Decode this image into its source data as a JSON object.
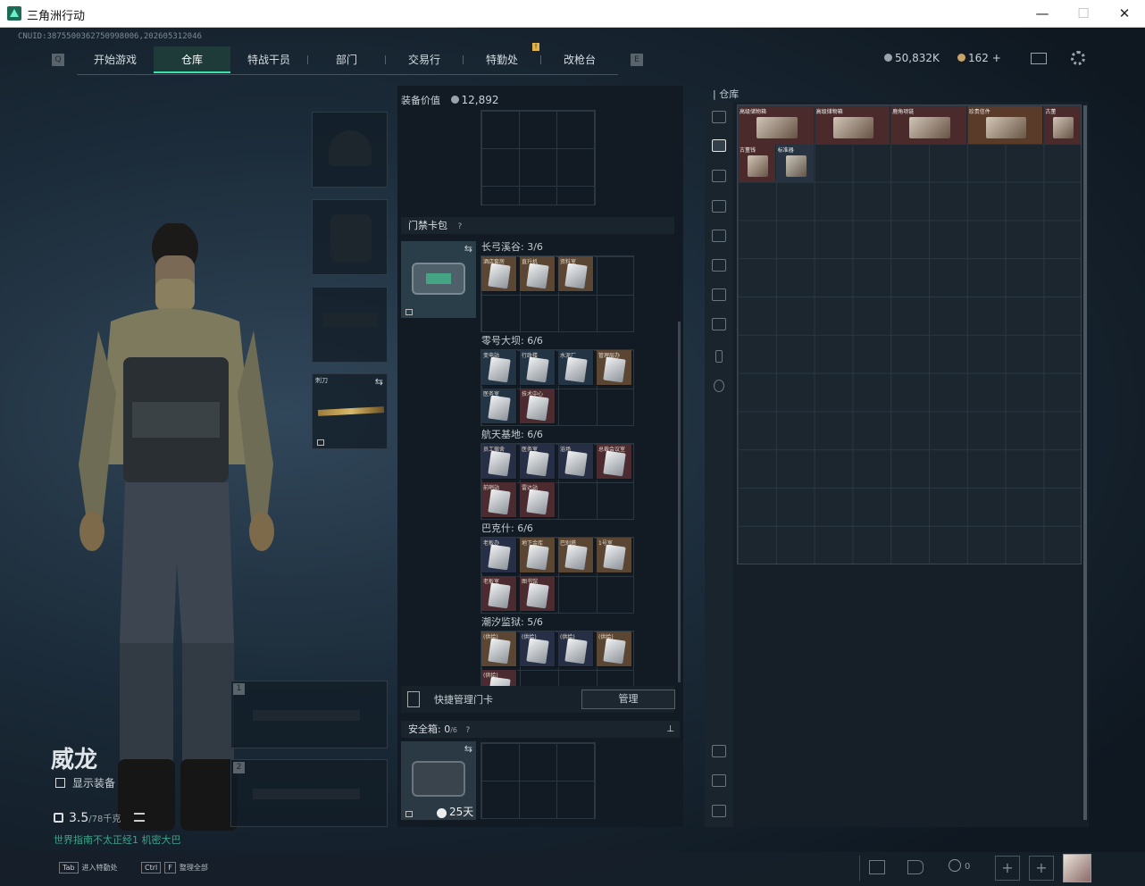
{
  "window": {
    "title": "三角洲行动",
    "minimize": "—",
    "maximize": "☐",
    "close": "✕"
  },
  "cnuid": "CNUID:3875500362750998006,202605312046",
  "nav": {
    "left_key": "Q",
    "right_key": "E",
    "tabs": [
      {
        "label": "开始游戏"
      },
      {
        "label": "仓库",
        "active": true
      },
      {
        "label": "特战干员"
      },
      {
        "label": "部门"
      },
      {
        "label": "交易行"
      },
      {
        "label": "特勤处"
      },
      {
        "label": "改枪台"
      }
    ],
    "notification_badge": "!"
  },
  "currency": {
    "hafcoin": "50,832K",
    "coupon": "162",
    "plus": "+"
  },
  "operator": {
    "name": "威龙",
    "show_equipment": "显示装备",
    "weight": "3.5",
    "weight_unit": "/78千克",
    "status": "世界指南不太正经1 机密大巴"
  },
  "gear_slots": {
    "melee_label": "刺刀"
  },
  "weapon_slots": [
    "1",
    "2"
  ],
  "middle": {
    "equipment_value_label": "装备价值",
    "equipment_value": "12,892",
    "keycard_section": "门禁卡包",
    "help": "?",
    "groups": [
      {
        "name": "长弓溪谷: 3/6",
        "cards": [
          {
            "label": "酒店套房",
            "color": "gold"
          },
          {
            "label": "直升机",
            "color": "gold"
          },
          {
            "label": "资料室",
            "color": "gold"
          }
        ]
      },
      {
        "name": "零号大坝: 6/6",
        "cards": [
          {
            "label": "变电站",
            "color": "blue"
          },
          {
            "label": "行政楼",
            "color": "blue"
          },
          {
            "label": "水泥厂",
            "color": "blue"
          },
          {
            "label": "管理层办",
            "color": "gold"
          },
          {
            "label": "医务室",
            "color": "blue"
          },
          {
            "label": "技术中心",
            "color": "red"
          }
        ]
      },
      {
        "name": "航天基地: 6/6",
        "cards": [
          {
            "label": "员工宿舍",
            "color": "navy"
          },
          {
            "label": "医务室",
            "color": "navy"
          },
          {
            "label": "浴场",
            "color": "navy"
          },
          {
            "label": "总裁会议室",
            "color": "red"
          },
          {
            "label": "前哨站",
            "color": "red"
          },
          {
            "label": "雷达站",
            "color": "red"
          }
        ]
      },
      {
        "name": "巴克什: 6/6",
        "cards": [
          {
            "label": "老板办",
            "color": "navy"
          },
          {
            "label": "地下金库",
            "color": "gold"
          },
          {
            "label": "巴别塔",
            "color": "gold"
          },
          {
            "label": "1号室",
            "color": "gold"
          },
          {
            "label": "老板室",
            "color": "red"
          },
          {
            "label": "图书馆",
            "color": "red"
          }
        ]
      },
      {
        "name": "潮汐监狱: 5/6",
        "cards": [
          {
            "label": "(供给)",
            "color": "gold"
          },
          {
            "label": "(供给)",
            "color": "navy"
          },
          {
            "label": "(供给)",
            "color": "navy"
          },
          {
            "label": "(供给)",
            "color": "gold"
          },
          {
            "label": "(供给)",
            "color": "red"
          }
        ]
      }
    ],
    "quick_manage_label": "快捷管理门卡",
    "manage_button": "管理",
    "safebox_label": "安全箱:",
    "safebox_count": "0",
    "safebox_max": "/6",
    "safebox_days": "25天"
  },
  "warehouse": {
    "label": "仓库",
    "items": [
      {
        "label": "高级储物箱",
        "color": "#4a2a2a"
      },
      {
        "label": "高级储物箱",
        "color": "#4a2a2a"
      },
      {
        "label": "鹿角项链",
        "color": "#4a2a2a"
      },
      {
        "label": "珍贵信件",
        "color": "#5a3a28"
      },
      {
        "label": "古董",
        "color": "#4a2a2a"
      },
      {
        "label": "古董钱",
        "color": "#4a2a2a"
      },
      {
        "label": "标准器",
        "color": "#273340"
      }
    ]
  },
  "bottom": {
    "tab_key": "Tab",
    "tab_text": "进入特勤处",
    "ctrl_key": "Ctrl",
    "f_key": "F",
    "f_text": "整理全部",
    "friends_count": "0",
    "plus": "+"
  }
}
